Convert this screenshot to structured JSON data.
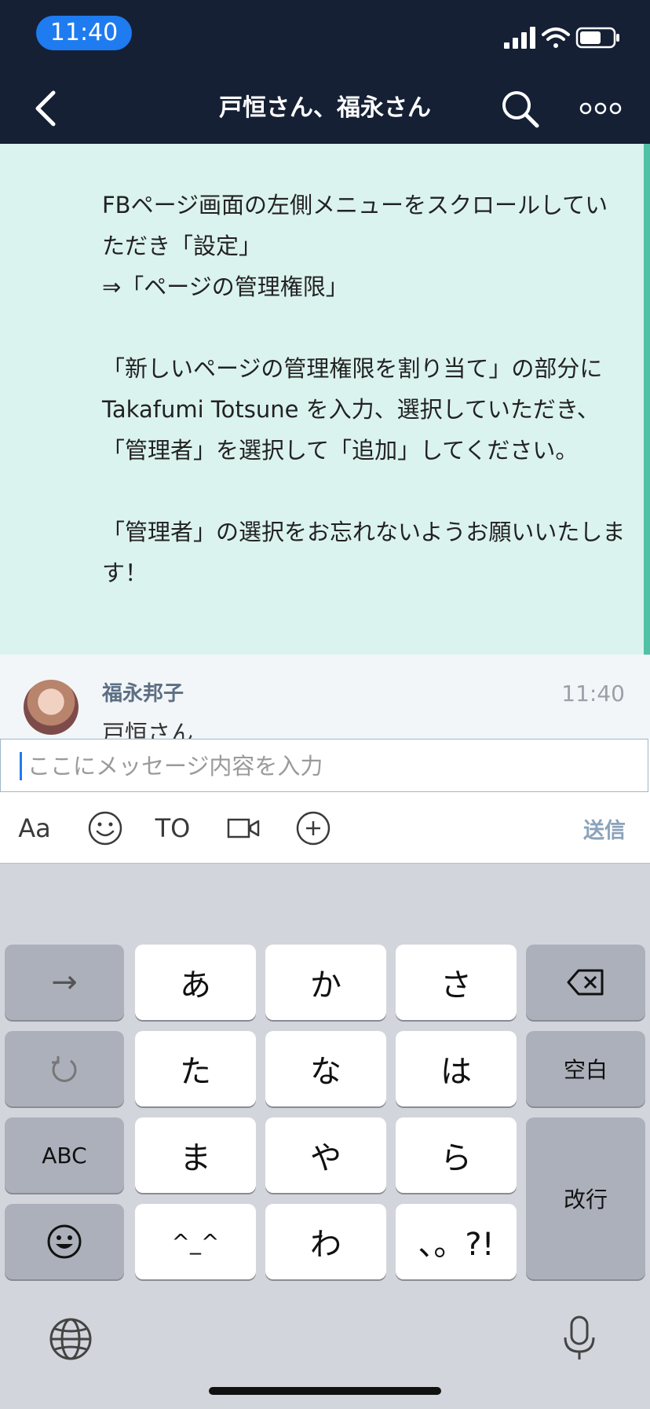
{
  "status_bar": {
    "time": "11:40"
  },
  "header": {
    "title": "戸恒さん、福永さん"
  },
  "quoted_message": {
    "text": "FBページ画面の左側メニューをスクロールしていただき「設定」\n⇒「ページの管理権限」\n\n「新しいページの管理権限を割り当て」の部分に Takafumi Totsune を入力、選択していただき、\n「管理者」を選択して「追加」してください。\n\n「管理者」の選択をお忘れないようお願いいたします！"
  },
  "message": {
    "sender": "福永邦子",
    "time": "11:40",
    "preview": "戸恒さん"
  },
  "input": {
    "placeholder": "ここにメッセージ内容を入力"
  },
  "toolbar": {
    "font_label": "Aa",
    "to_label": "TO",
    "send_label": "送信"
  },
  "keyboard": {
    "rows": [
      [
        "→",
        "あ",
        "か",
        "さ",
        "⌫"
      ],
      [
        "↺",
        "た",
        "な",
        "は",
        "空白"
      ],
      [
        "ABC",
        "ま",
        "や",
        "ら",
        "改行"
      ],
      [
        "☺",
        "^_^",
        "わ",
        "、。?!"
      ]
    ]
  },
  "icons": {
    "back": "chevron-left-icon",
    "search": "search-icon",
    "more": "more-horizontal-icon",
    "emoji": "smiley-icon",
    "video": "video-camera-icon",
    "add": "plus-circle-icon",
    "globe": "globe-icon",
    "mic": "microphone-icon"
  }
}
